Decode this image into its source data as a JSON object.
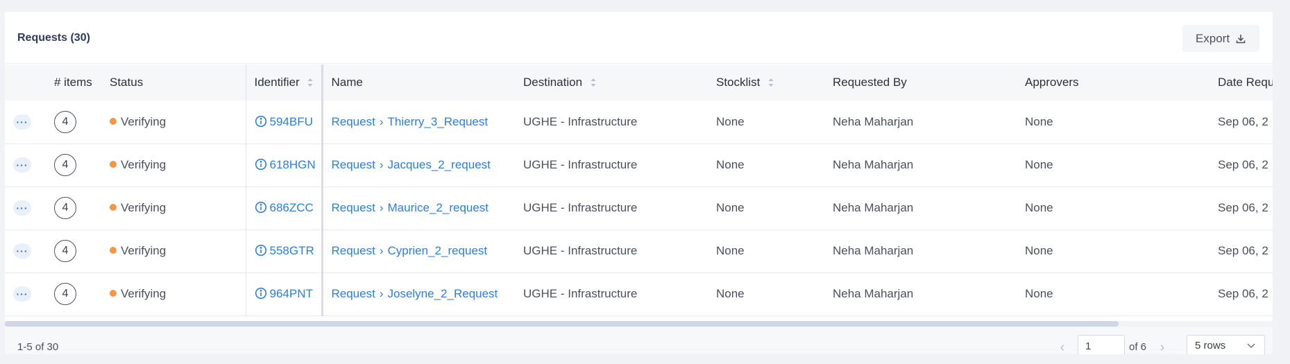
{
  "header": {
    "title": "Requests (30)",
    "export_label": "Export"
  },
  "table": {
    "columns": [
      "",
      "# items",
      "Status",
      "Identifier",
      "Name",
      "Destination",
      "Stocklist",
      "Requested By",
      "Approvers",
      "Date Requ"
    ],
    "rows": [
      {
        "items": "4",
        "status": "Verifying",
        "identifier": "594BFU",
        "name_prefix": "Request",
        "name": "Thierry_3_Request",
        "destination": "UGHE - Infrastructure",
        "stocklist": "None",
        "requested_by": "Neha Maharjan",
        "approvers": "None",
        "date": "Sep 06, 2"
      },
      {
        "items": "4",
        "status": "Verifying",
        "identifier": "618HGN",
        "name_prefix": "Request",
        "name": "Jacques_2_request",
        "destination": "UGHE - Infrastructure",
        "stocklist": "None",
        "requested_by": "Neha Maharjan",
        "approvers": "None",
        "date": "Sep 06, 2"
      },
      {
        "items": "4",
        "status": "Verifying",
        "identifier": "686ZCC",
        "name_prefix": "Request",
        "name": "Maurice_2_request",
        "destination": "UGHE - Infrastructure",
        "stocklist": "None",
        "requested_by": "Neha Maharjan",
        "approvers": "None",
        "date": "Sep 06, 2"
      },
      {
        "items": "4",
        "status": "Verifying",
        "identifier": "558GTR",
        "name_prefix": "Request",
        "name": "Cyprien_2_request",
        "destination": "UGHE - Infrastructure",
        "stocklist": "None",
        "requested_by": "Neha Maharjan",
        "approvers": "None",
        "date": "Sep 06, 2"
      },
      {
        "items": "4",
        "status": "Verifying",
        "identifier": "964PNT",
        "name_prefix": "Request",
        "name": "Joselyne_2_Request",
        "destination": "UGHE - Infrastructure",
        "stocklist": "None",
        "requested_by": "Neha Maharjan",
        "approvers": "None",
        "date": "Sep 06, 2"
      }
    ]
  },
  "footer": {
    "range": "1-5 of 30",
    "page_value": "1",
    "page_of": "of 6",
    "rows_per_page": "5 rows"
  },
  "colors": {
    "status_verifying": "#f0974a",
    "link": "#2a7ee0"
  },
  "icons": {
    "export": "download-icon",
    "more": "ellipsis-icon",
    "info": "info-circle-icon",
    "sort": "sort-icon",
    "prev": "chevron-left-icon",
    "next": "chevron-right-icon",
    "dropdown": "chevron-down-icon"
  }
}
